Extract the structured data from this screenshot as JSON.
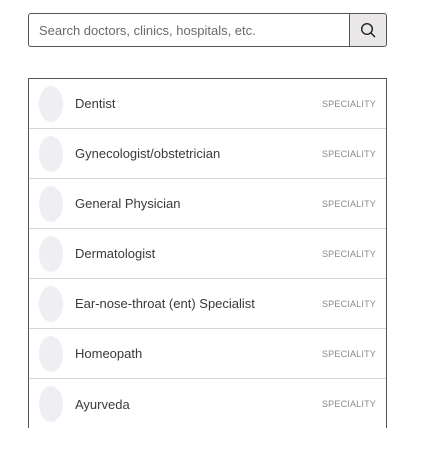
{
  "search": {
    "placeholder": "Search doctors, clinics, hospitals, etc.",
    "value": "",
    "button_icon": "search-icon"
  },
  "results": [
    {
      "name": "Dentist",
      "type": "SPECIALITY"
    },
    {
      "name": "Gynecologist/obstetrician",
      "type": "SPECIALITY"
    },
    {
      "name": "General Physician",
      "type": "SPECIALITY"
    },
    {
      "name": "Dermatologist",
      "type": "SPECIALITY"
    },
    {
      "name": "Ear-nose-throat (ent) Specialist",
      "type": "SPECIALITY"
    },
    {
      "name": "Homeopath",
      "type": "SPECIALITY"
    },
    {
      "name": "Ayurveda",
      "type": "SPECIALITY"
    }
  ],
  "colors": {
    "border": "#555555",
    "button_bg": "#e9e7e7",
    "avatar_bg": "#eeeef3",
    "divider": "#d6d6d6"
  }
}
